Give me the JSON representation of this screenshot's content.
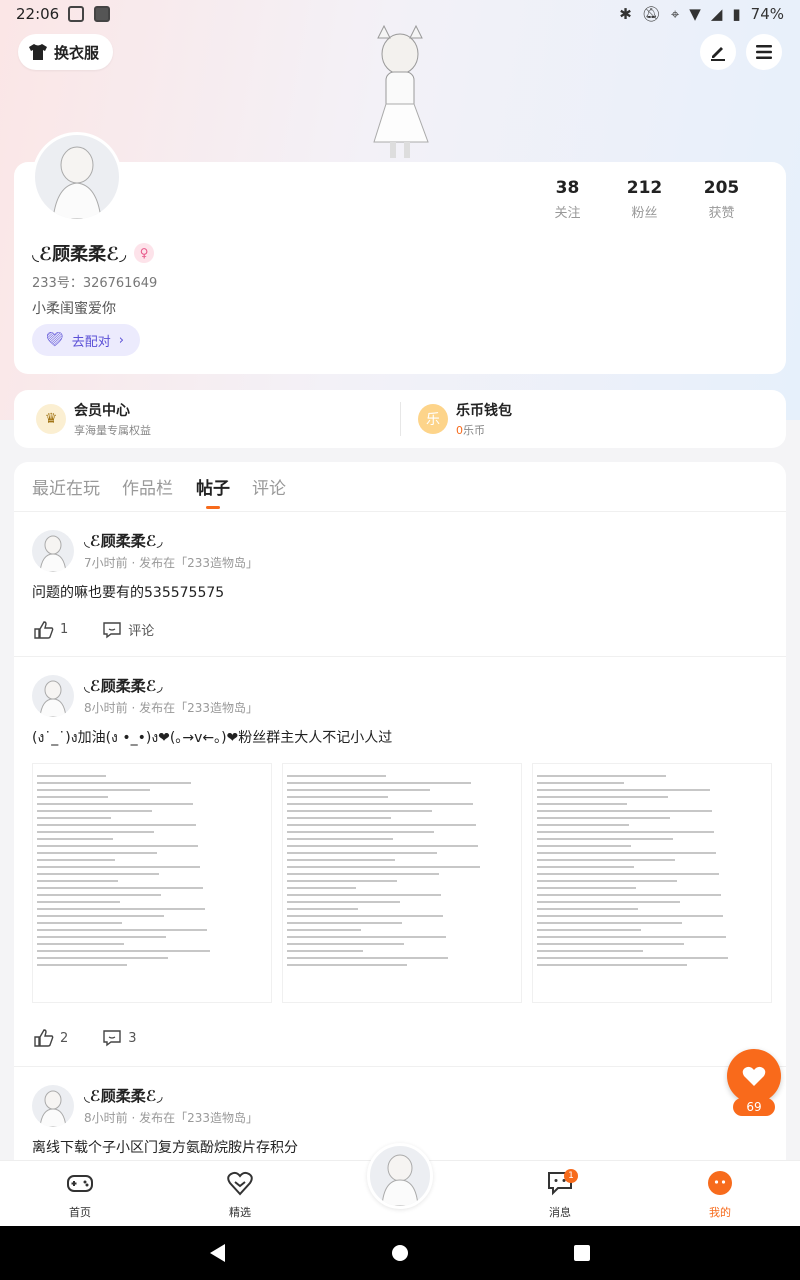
{
  "status_bar": {
    "time": "22:06",
    "battery": "74%"
  },
  "header": {
    "outfit_label": "换衣服"
  },
  "profile": {
    "nickname": "◟ℰ顾柔柔ℰ◞",
    "uid": "233号：326761649",
    "bio": "小柔闺蜜爱你",
    "match_label": "去配对",
    "stats": [
      {
        "num": "38",
        "label": "关注"
      },
      {
        "num": "212",
        "label": "粉丝"
      },
      {
        "num": "205",
        "label": "获赞"
      }
    ]
  },
  "vip": {
    "member_title": "会员中心",
    "member_sub": "享海量专属权益",
    "wallet_title": "乐币钱包",
    "wallet_count": "0",
    "wallet_unit": "乐币"
  },
  "tabs": [
    {
      "label": "最近在玩",
      "active": false
    },
    {
      "label": "作品栏",
      "active": false
    },
    {
      "label": "帖子",
      "active": true
    },
    {
      "label": "评论",
      "active": false
    }
  ],
  "posts": [
    {
      "name": "◟ℰ顾柔柔ℰ◞",
      "meta": "7小时前 · 发布在「233造物岛」",
      "text": "问题的嘛也要有的535575575",
      "likes": "1",
      "comments": "评论"
    },
    {
      "name": "◟ℰ顾柔柔ℰ◞",
      "meta": "8小时前 · 发布在「233造物岛」",
      "text": "(ง˙_˙)ง加油(ง •_•)ง❤(｡→v←｡)❤粉丝群主大人不记小人过",
      "likes": "2",
      "comments": "3"
    },
    {
      "name": "◟ℰ顾柔柔ℰ◞",
      "meta": "8小时前 · 发布在「233造物岛」",
      "text": "离线下载个子小区门复方氨酚烷胺片存积分"
    }
  ],
  "float_like_count": "69",
  "bottom_nav": [
    {
      "label": "首页",
      "icon": "gamepad-icon"
    },
    {
      "label": "精选",
      "icon": "heart-bubble-icon"
    },
    {
      "label": "消息",
      "icon": "message-icon",
      "badge": "1"
    },
    {
      "label": "我的",
      "icon": "profile-face-icon",
      "active": true
    }
  ],
  "colors": {
    "accent": "#f76b1c",
    "match": "#5a4fd6"
  }
}
